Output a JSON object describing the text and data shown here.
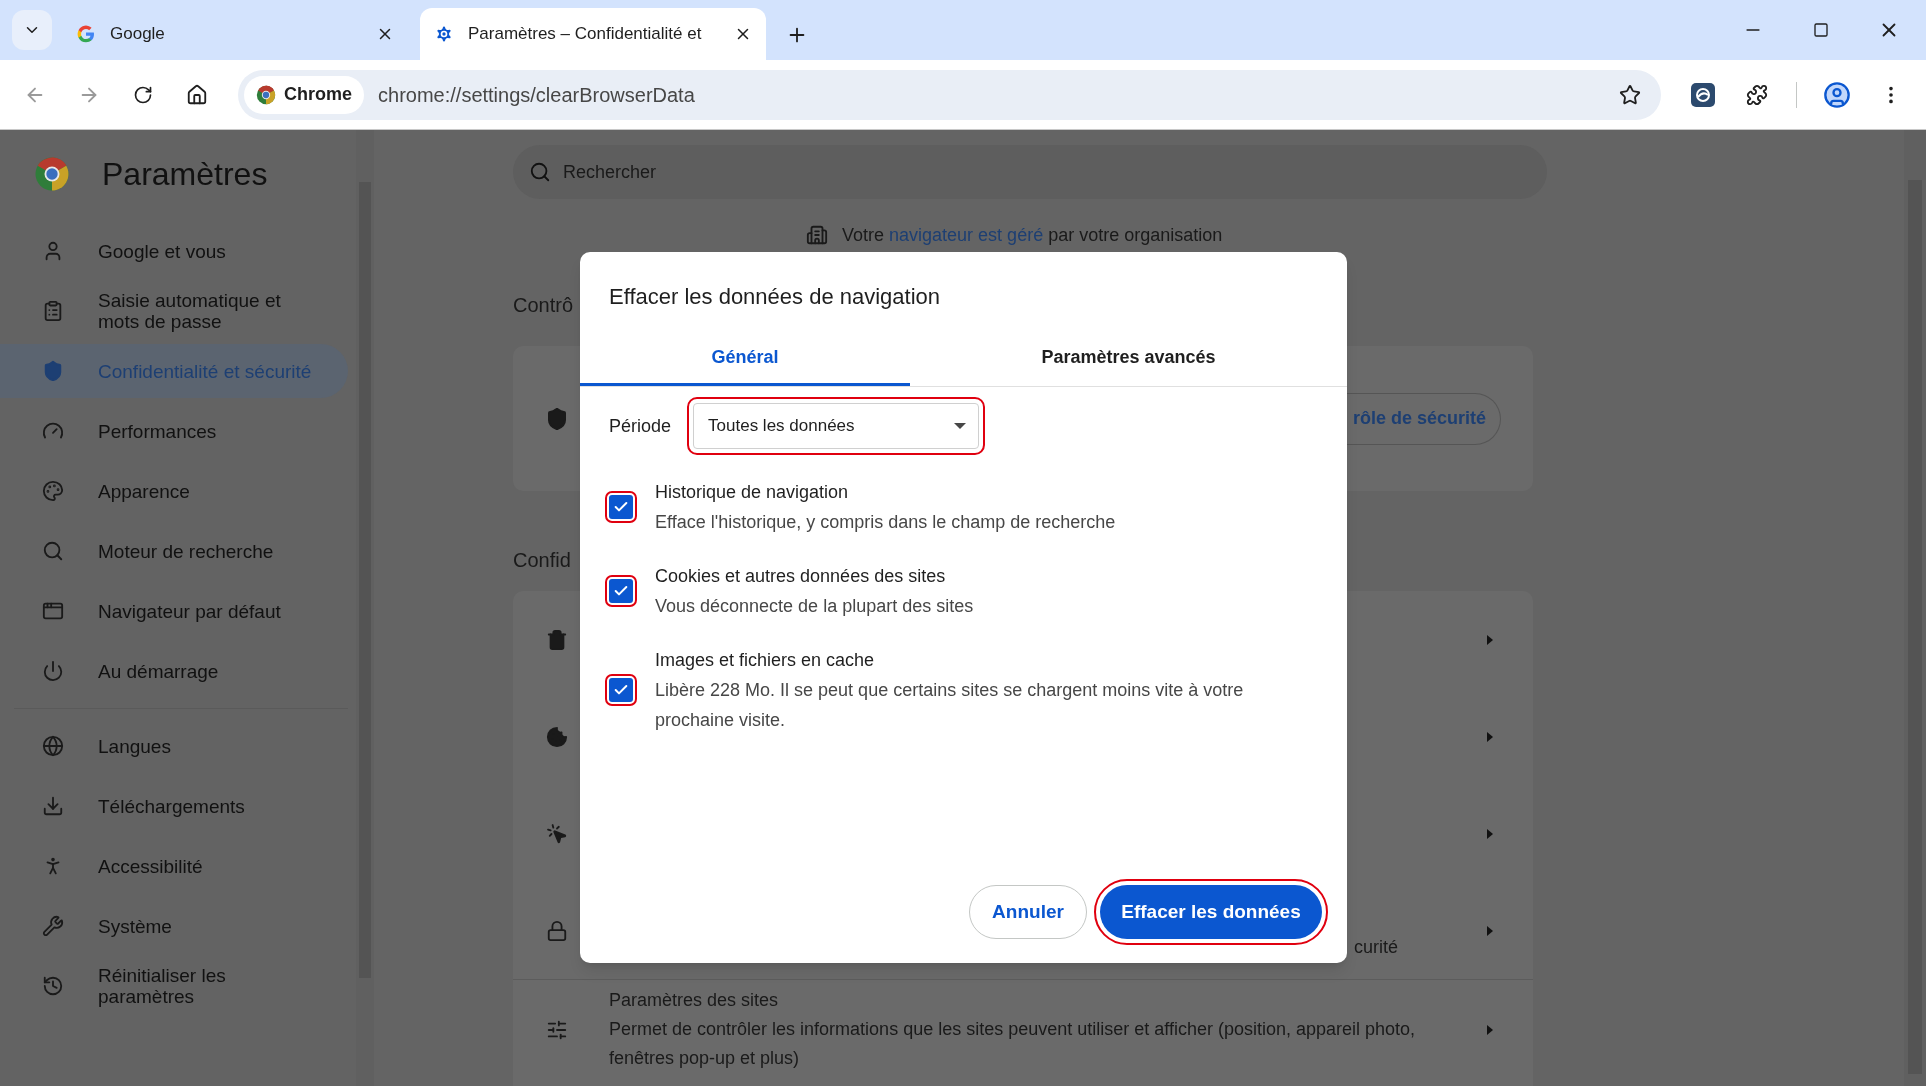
{
  "browser": {
    "tabs": [
      {
        "title": "Google",
        "selected": false,
        "kind": "google"
      },
      {
        "title": "Paramètres – Confidentialité et",
        "selected": true,
        "kind": "settings"
      }
    ],
    "address_chip": "Chrome",
    "url": "chrome://settings/clearBrowserData"
  },
  "sidebar": {
    "title": "Paramètres",
    "groups": [
      [
        {
          "label": "Google et vous",
          "selected": false
        },
        {
          "label": "Saisie automatique et mots de passe",
          "selected": false
        },
        {
          "label": "Confidentialité et sécurité",
          "selected": true
        },
        {
          "label": "Performances",
          "selected": false
        },
        {
          "label": "Apparence",
          "selected": false
        },
        {
          "label": "Moteur de recherche",
          "selected": false
        },
        {
          "label": "Navigateur par défaut",
          "selected": false
        },
        {
          "label": "Au démarrage",
          "selected": false
        }
      ],
      [
        {
          "label": "Langues",
          "selected": false
        },
        {
          "label": "Téléchargements",
          "selected": false
        },
        {
          "label": "Accessibilité",
          "selected": false
        },
        {
          "label": "Système",
          "selected": false
        },
        {
          "label": "Réinitialiser les paramètres",
          "selected": false
        }
      ]
    ]
  },
  "main": {
    "search": {
      "placeholder": "Rechercher"
    },
    "notice": {
      "before": "Votre",
      "link": "navigateur est géré",
      "after": "par votre organisation"
    },
    "section_1_heading": "Contrô",
    "security_button": "rôle de sécurité",
    "section_2_heading": "Confid",
    "row_4_fragment": "curité",
    "site_settings": {
      "title": "Paramètres des sites",
      "description": "Permet de contrôler les informations que les sites peuvent utiliser et afficher (position, appareil photo, fenêtres pop-up et plus)"
    }
  },
  "dialog": {
    "title": "Effacer les données de navigation",
    "tabs": [
      {
        "label": "Général",
        "selected": true
      },
      {
        "label": "Paramètres avancés",
        "selected": false
      }
    ],
    "period": {
      "label": "Période",
      "value": "Toutes les données",
      "highlighted": true
    },
    "options": [
      {
        "title": "Historique de navigation",
        "description": "Efface l'historique, y compris dans le champ de recherche",
        "checked": true,
        "highlighted": true
      },
      {
        "title": "Cookies et autres données des sites",
        "description": "Vous déconnecte de la plupart des sites",
        "checked": true,
        "highlighted": true
      },
      {
        "title": "Images et fichiers en cache",
        "description": "Libère 228 Mo. Il se peut que certains sites se chargent moins vite à votre prochaine visite.",
        "checked": true,
        "highlighted": true
      }
    ],
    "buttons": [
      {
        "label": "Annuler",
        "kind": "secondary",
        "highlighted": false
      },
      {
        "label": "Effacer les données",
        "kind": "primary",
        "highlighted": true
      }
    ]
  }
}
